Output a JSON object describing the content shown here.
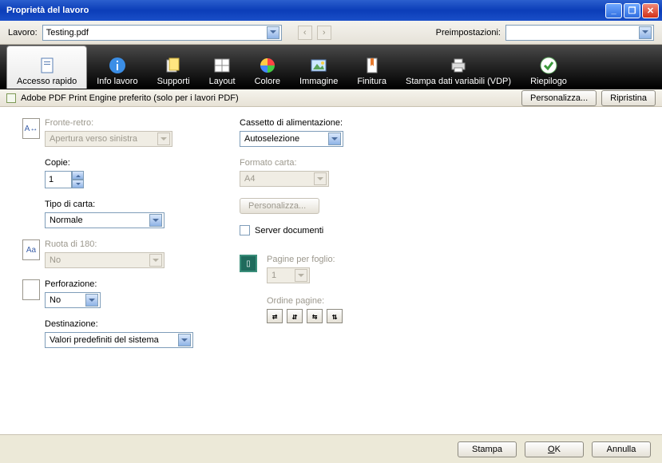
{
  "window": {
    "title": "Proprietà del lavoro"
  },
  "top": {
    "job_label": "Lavoro:",
    "job_value": "Testing.pdf",
    "preset_label": "Preimpostazioni:",
    "preset_value": ""
  },
  "tabs": [
    {
      "id": "quick",
      "label": "Accesso rapido"
    },
    {
      "id": "info",
      "label": "Info lavoro"
    },
    {
      "id": "media",
      "label": "Supporti"
    },
    {
      "id": "layout",
      "label": "Layout"
    },
    {
      "id": "color",
      "label": "Colore"
    },
    {
      "id": "image",
      "label": "Immagine"
    },
    {
      "id": "finish",
      "label": "Finitura"
    },
    {
      "id": "vdp",
      "label": "Stampa dati variabili (VDP)"
    },
    {
      "id": "summary",
      "label": "Riepilogo"
    }
  ],
  "enginebar": {
    "label": "Adobe PDF Print Engine preferito (solo per i lavori PDF)",
    "customize": "Personalizza...",
    "reset": "Ripristina"
  },
  "left": {
    "duplex_label": "Fronte-retro:",
    "duplex_value": "Apertura verso sinistra",
    "copies_label": "Copie:",
    "copies_value": "1",
    "paper_type_label": "Tipo di carta:",
    "paper_type_value": "Normale",
    "rotate_label": "Ruota di 180:",
    "rotate_value": "No",
    "punch_label": "Perforazione:",
    "punch_value": "No",
    "dest_label": "Destinazione:",
    "dest_value": "Valori predefiniti del sistema"
  },
  "right": {
    "tray_label": "Cassetto di alimentazione:",
    "tray_value": "Autoselezione",
    "paper_size_label": "Formato carta:",
    "paper_size_value": "A4",
    "paper_customize": "Personalizza...",
    "docserver_label": "Server documenti",
    "pps_label": "Pagine per foglio:",
    "pps_value": "1",
    "order_label": "Ordine pagine:"
  },
  "footer": {
    "print": "Stampa",
    "ok": "OK",
    "ok_u": "O",
    "cancel": "Annulla"
  }
}
